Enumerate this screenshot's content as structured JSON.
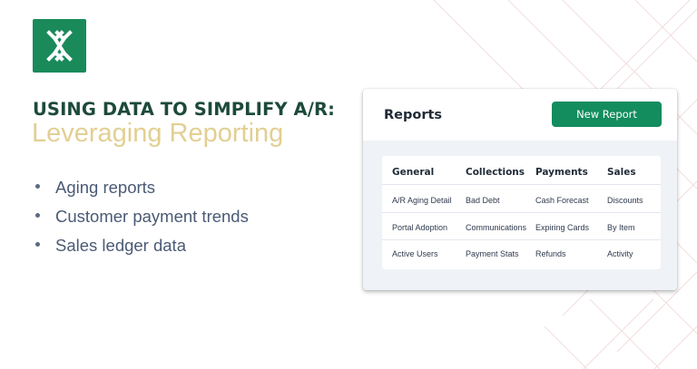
{
  "brand": {
    "logo_icon": "x-arrows-logo-icon",
    "color": "#1a8a5a"
  },
  "hero": {
    "headline": "USING DATA TO SIMPLIFY A/R:",
    "subheadline": "Leveraging Reporting",
    "bullets": [
      "Aging reports",
      "Customer payment trends",
      "Sales ledger data"
    ]
  },
  "reports_panel": {
    "title": "Reports",
    "new_report_label": "New Report",
    "columns": [
      "General",
      "Collections",
      "Payments",
      "Sales"
    ],
    "rows": [
      [
        "A/R Aging Detail",
        "Bad Debt",
        "Cash Forecast",
        "Discounts"
      ],
      [
        "Portal Adoption",
        "Communications",
        "Expiring Cards",
        "By Item"
      ],
      [
        "Active Users",
        "Payment Stats",
        "Refunds",
        "Activity"
      ]
    ]
  },
  "colors": {
    "accent_green": "#138c5e",
    "headline": "#1d4a3a",
    "subheadline": "#e2cf93"
  }
}
